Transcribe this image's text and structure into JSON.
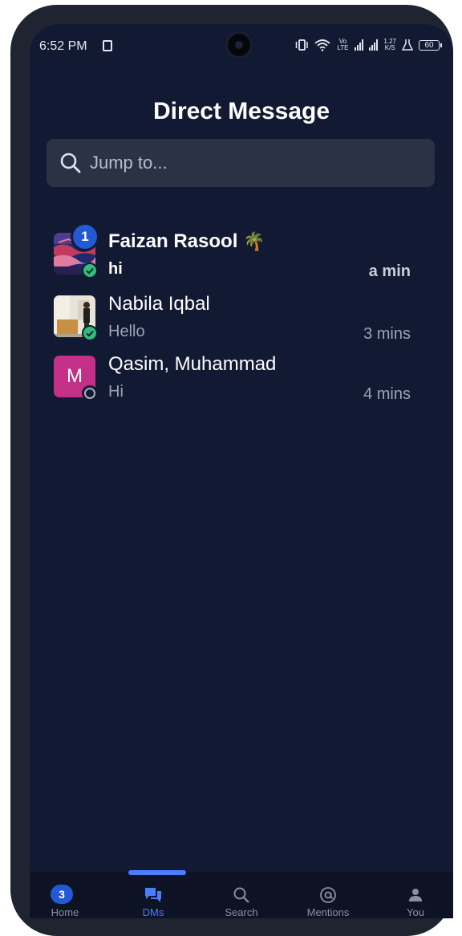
{
  "status_bar": {
    "time": "6:52 PM",
    "volte": "Vo LTE",
    "speed_value": "1.27",
    "speed_unit": "K/S",
    "battery": "60"
  },
  "header": {
    "title": "Direct Message"
  },
  "search": {
    "placeholder": "Jump to..."
  },
  "conversations": [
    {
      "name": "Faizan Rasool",
      "emoji": "🌴",
      "preview": "hi",
      "time": "a min",
      "unread": "1",
      "status": "online"
    },
    {
      "name": "Nabila Iqbal",
      "preview": "Hello",
      "time": "3 mins",
      "status": "online"
    },
    {
      "name": "Qasim, Muhammad",
      "initial": "M",
      "preview": "Hi",
      "time": "4 mins",
      "status": "offline"
    }
  ],
  "tabbar": {
    "tabs": [
      {
        "label": "Home",
        "badge": "3",
        "icon": "home-badge"
      },
      {
        "label": "DMs",
        "icon": "chat-bubbles-icon"
      },
      {
        "label": "Search",
        "icon": "search-icon"
      },
      {
        "label": "Mentions",
        "icon": "at-sign-icon"
      },
      {
        "label": "You",
        "icon": "person-icon"
      }
    ],
    "active": "DMs"
  },
  "colors": {
    "background": "#121a33",
    "accent": "#4a7dff",
    "unread_badge": "#2459d6",
    "online": "#2fbd7a",
    "avatar_m": "#c42f88"
  }
}
